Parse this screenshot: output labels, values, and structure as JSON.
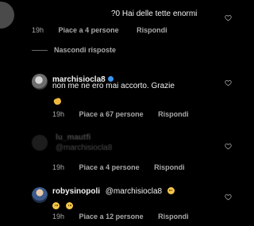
{
  "top_comment": {
    "text_prefix": "?0",
    "text": "Hai delle tette enormi",
    "time": "19h",
    "likes": "Piace a 4 persone",
    "reply": "Rispondi"
  },
  "replies_toggle": {
    "label": "Nascondi risposte"
  },
  "reply1": {
    "username": "marchisiocla8",
    "text": "non me ne ero mai accorto. Grazie",
    "time": "19h",
    "likes": "Piace a 67 persone",
    "reply": "Rispondi"
  },
  "reply2": {
    "username_blurred": "lu_mautfi",
    "text_blurred": "@marchisiocla8",
    "time": "19h",
    "likes": "Piace a 4 persone",
    "reply": "Rispondi"
  },
  "reply3": {
    "username": "robysinopoli",
    "mention": "@marchisiocla8",
    "time": "19h",
    "likes": "Piace a 12 persone",
    "reply": "Rispondi"
  },
  "colors": {
    "background": "#000000",
    "text": "#f2f2f2",
    "muted": "#a8a8a8",
    "verified": "#3897f0"
  }
}
